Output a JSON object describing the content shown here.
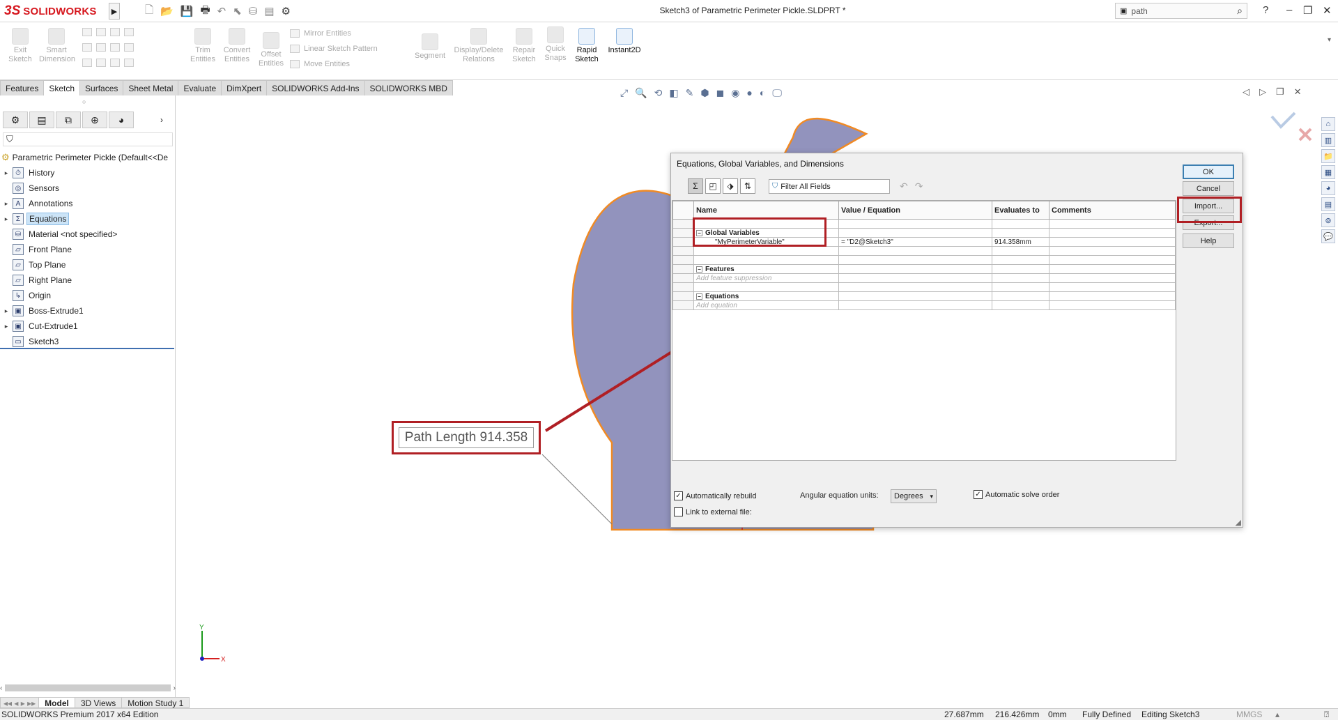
{
  "app": {
    "logo_ds": "3S",
    "logo_text": "SOLIDWORKS",
    "doc_title": "Sketch3 of Parametric Perimeter Pickle.SLDPRT *",
    "search_placeholder": "path",
    "win_help": "?",
    "win_min": "–",
    "win_max": "❐",
    "win_close": "✕"
  },
  "commands": {
    "exit_sketch": [
      "Exit",
      "Sketch"
    ],
    "smart_dimension": [
      "Smart",
      "Dimension"
    ],
    "trim_entities": [
      "Trim",
      "Entities"
    ],
    "convert_entities": [
      "Convert",
      "Entities"
    ],
    "offset_entities": [
      "Offset",
      "Entities"
    ],
    "mirror_entities": "Mirror Entities",
    "linear_sketch_pattern": "Linear Sketch Pattern",
    "move_entities": "Move Entities",
    "segment": "Segment",
    "display_delete_relations": [
      "Display/Delete",
      "Relations"
    ],
    "repair_sketch": [
      "Repair",
      "Sketch"
    ],
    "quick_snaps": [
      "Quick",
      "Snaps"
    ],
    "rapid_sketch": [
      "Rapid",
      "Sketch"
    ],
    "instant2d": "Instant2D"
  },
  "tabs": [
    "Features",
    "Sketch",
    "Surfaces",
    "Sheet Metal",
    "Evaluate",
    "DimXpert",
    "SOLIDWORKS Add-Ins",
    "SOLIDWORKS MBD"
  ],
  "tree": {
    "root": "Parametric Perimeter Pickle  (Default<<De",
    "items": [
      {
        "label": "History",
        "expand": "▸"
      },
      {
        "label": "Sensors",
        "expand": ""
      },
      {
        "label": "Annotations",
        "expand": "▸"
      },
      {
        "label": "Equations",
        "expand": "▸"
      },
      {
        "label": "Material <not specified>",
        "expand": ""
      },
      {
        "label": "Front Plane",
        "expand": ""
      },
      {
        "label": "Top Plane",
        "expand": ""
      },
      {
        "label": "Right Plane",
        "expand": ""
      },
      {
        "label": "Origin",
        "expand": ""
      },
      {
        "label": "Boss-Extrude1",
        "expand": "▸"
      },
      {
        "label": "Cut-Extrude1",
        "expand": "▸"
      },
      {
        "label": "Sketch3",
        "expand": ""
      }
    ]
  },
  "callout": {
    "text": "Path Length 914.358"
  },
  "dialog": {
    "title": "Equations, Global Variables, and Dimensions",
    "filter_placeholder": "Filter All Fields",
    "columns": [
      "Name",
      "Value / Equation",
      "Evaluates to",
      "Comments"
    ],
    "groups": {
      "global_variables": "Global Variables",
      "features": "Features",
      "equations": "Equations"
    },
    "rows": {
      "var_name": "\"MyPerimeterVariable\"",
      "var_value": "= \"D2@Sketch3\"",
      "var_eval": "914.358mm",
      "feature_hint": "Add feature suppression",
      "equation_hint": "Add equation"
    },
    "buttons": {
      "ok": "OK",
      "cancel": "Cancel",
      "import": "Import...",
      "export": "Export...",
      "help": "Help"
    },
    "auto_rebuild": "Automatically rebuild",
    "angular_units_label": "Angular equation units:",
    "angular_units_value": "Degrees",
    "auto_solve": "Automatic solve order",
    "link_external": "Link to external file:"
  },
  "bottom_tabs": [
    "Model",
    "3D Views",
    "Motion Study 1"
  ],
  "status": {
    "edition": "SOLIDWORKS Premium 2017 x64 Edition",
    "x": "27.687mm",
    "y": "216.426mm",
    "z": "0mm",
    "state": "Fully Defined",
    "mode": "Editing Sketch3",
    "units": "MMGS"
  },
  "colors": {
    "accent_red": "#b01f24",
    "sketch_fill": "#9293bd",
    "sketch_edge": "#f08a24"
  }
}
